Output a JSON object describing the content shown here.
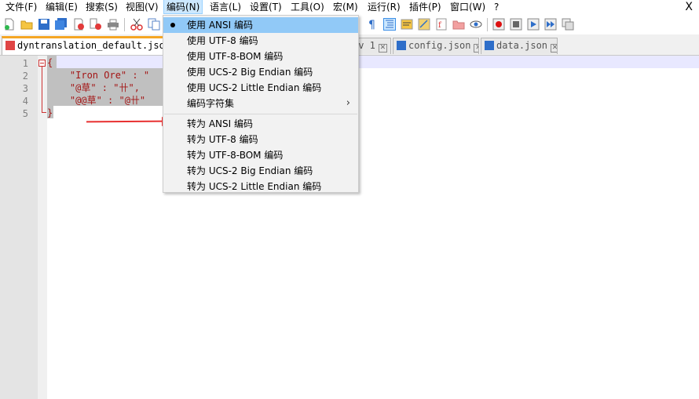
{
  "menubar": {
    "items": [
      {
        "label": "文件(F)"
      },
      {
        "label": "编辑(E)"
      },
      {
        "label": "搜索(S)"
      },
      {
        "label": "视图(V)"
      },
      {
        "label": "编码(N)"
      },
      {
        "label": "语言(L)"
      },
      {
        "label": "设置(T)"
      },
      {
        "label": "工具(O)"
      },
      {
        "label": "宏(M)"
      },
      {
        "label": "运行(R)"
      },
      {
        "label": "插件(P)"
      },
      {
        "label": "窗口(W)"
      },
      {
        "label": "?"
      }
    ],
    "close_label": "X"
  },
  "tabs": [
    {
      "label": "dyntranslation_default.json"
    },
    {
      "label": "ev 1"
    },
    {
      "label": "config.json"
    },
    {
      "label": "data.json"
    }
  ],
  "editor": {
    "line_numbers": [
      "1",
      "2",
      "3",
      "4",
      "5"
    ],
    "lines": [
      "{",
      "    \"Iron Ore\" : \"",
      "    \"@草\" : \"卄\",",
      "    \"@@草\" : \"@卄\"",
      "}"
    ]
  },
  "encoding_menu": {
    "items": [
      {
        "label": "使用 ANSI 编码",
        "checked": true
      },
      {
        "label": "使用 UTF-8 编码"
      },
      {
        "label": "使用 UTF-8-BOM 编码"
      },
      {
        "label": "使用 UCS-2 Big Endian 编码"
      },
      {
        "label": "使用 UCS-2 Little Endian 编码"
      },
      {
        "label": "编码字符集",
        "submenu_arrow": "›"
      },
      {
        "label": "转为 ANSI 编码"
      },
      {
        "label": "转为 UTF-8 编码"
      },
      {
        "label": "转为 UTF-8-BOM 编码"
      },
      {
        "label": "转为 UCS-2 Big Endian 编码"
      },
      {
        "label": "转为 UCS-2 Little Endian 编码"
      }
    ]
  },
  "colors": {
    "accent": "#f5a623",
    "menu_highlight": "#91c9f7",
    "annotation_arrow": "#e83030",
    "code_string": "#a31515"
  },
  "toolbar_icons": [
    "new-file-icon",
    "open-file-icon",
    "save-icon",
    "save-all-icon",
    "close-icon",
    "close-all-icon",
    "print-icon",
    "cut-icon",
    "copy-icon",
    "show-all-chars-icon",
    "indent-guide-icon",
    "function-list-icon",
    "folder-as-workspace-icon",
    "document-map-icon",
    "folder-icon",
    "monitoring-eye-icon",
    "record-macro-icon",
    "stop-macro-icon",
    "play-macro-icon",
    "run-macro-multiple-icon",
    "save-macro-icon"
  ]
}
